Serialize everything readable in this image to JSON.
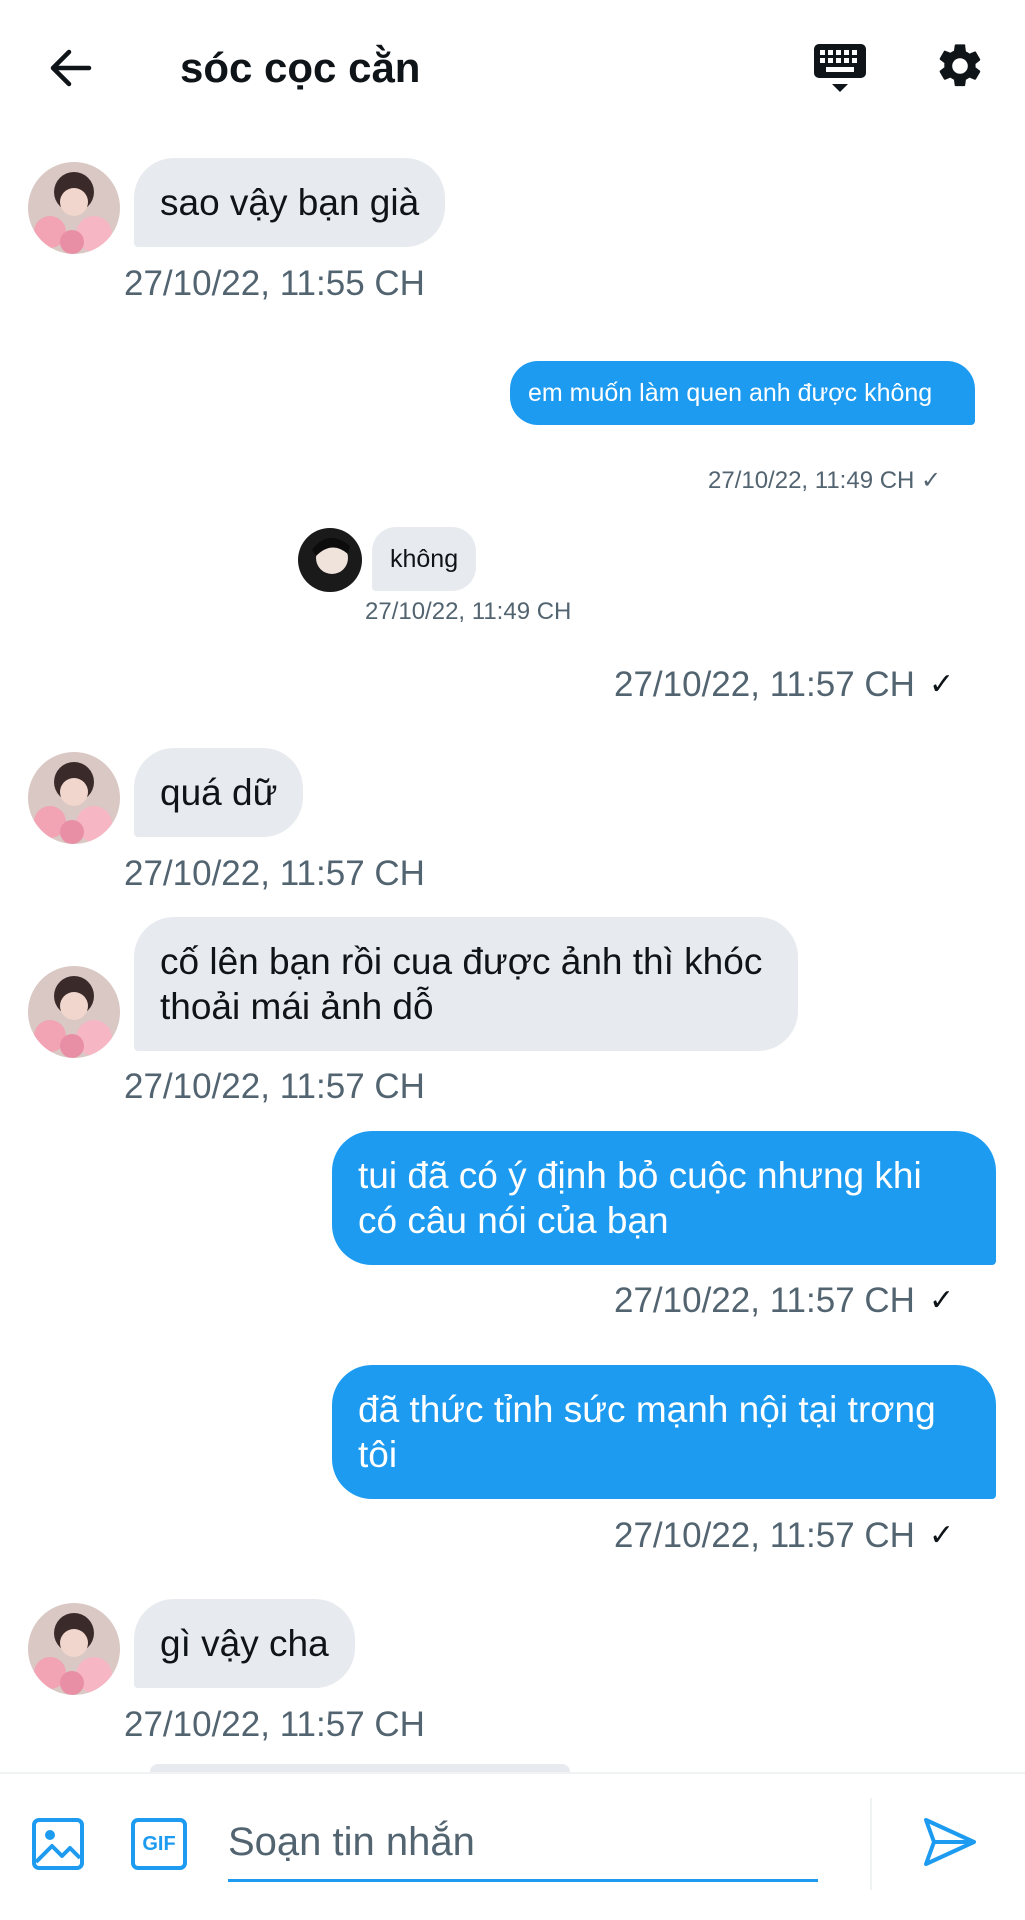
{
  "header": {
    "title": "sóc cọc cằn",
    "back_icon": "arrow-left-icon",
    "keyboard_icon": "keyboard-icon",
    "settings_icon": "gear-icon"
  },
  "messages": [
    {
      "side": "received",
      "text": "sao vậy bạn già",
      "time": "27/10/22, 11:55 CH"
    },
    {
      "side": "sent-embedded",
      "time": "27/10/22, 11:57 CH",
      "check": "✓",
      "embed": {
        "sent_text": "em muốn làm quen anh được không",
        "sent_time": "27/10/22, 11:49 CH",
        "sent_check": "✓",
        "recv_text": "không",
        "recv_time": "27/10/22, 11:49 CH"
      }
    },
    {
      "side": "received",
      "text": "quá dữ",
      "time": "27/10/22, 11:57 CH"
    },
    {
      "side": "received",
      "text": "cố lên bạn rồi cua được ảnh thì khóc thoải mái ảnh dỗ",
      "time": "27/10/22, 11:57 CH"
    },
    {
      "side": "sent",
      "text": "tui đã có ý định bỏ cuộc nhưng khi có câu nói của bạn",
      "time": "27/10/22, 11:57 CH",
      "check": "✓"
    },
    {
      "side": "sent",
      "text": "đã thức tỉnh sức mạnh nội tại trơng tôi",
      "time": "27/10/22, 11:57 CH",
      "check": "✓"
    },
    {
      "side": "received",
      "text": "gì vậy cha",
      "time": "27/10/22, 11:57 CH"
    }
  ],
  "composer": {
    "placeholder": "Soạn tin nhắn",
    "image_icon": "image-icon",
    "gif_icon": "gif-icon",
    "gif_label": "GIF",
    "send_icon": "send-icon"
  },
  "colors": {
    "accent": "#1d9bf0",
    "received_bubble": "#e7eaee",
    "timestamp": "#536471",
    "text": "#0f1419"
  }
}
